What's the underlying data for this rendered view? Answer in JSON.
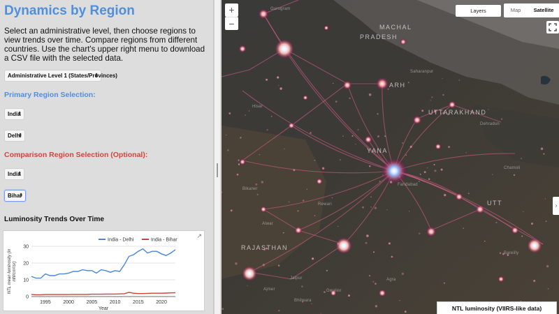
{
  "panel": {
    "title": "Dynamics by Region",
    "description": "Select an administrative level, then choose regions to view trends over time. Compare regions from different countries. Use the chart's upper right menu to download a CSV file with the selected data.",
    "admin_level_select": "Administrative Level 1 (States/Provinces)",
    "primary_heading": "Primary Region Selection:",
    "primary_country_select": "India",
    "primary_region_select": "Delhi",
    "comparison_heading": "Comparison Region Selection (Optional):",
    "comparison_country_select": "India",
    "comparison_region_select": "Bihar",
    "trend_heading": "Luminosity Trends Over Time"
  },
  "chart_data": {
    "type": "line",
    "title": "",
    "xlabel": "Year",
    "ylabel": "NTL mean luminosity (in nW/cm²/sr)",
    "ylabel_lines": [
      "NTL mean luminosity (in",
      "nW/cm²/sr)"
    ],
    "xlim": [
      1992,
      2023
    ],
    "ylim": [
      0,
      30
    ],
    "xticks": [
      "1995",
      "2000",
      "2005",
      "2010",
      "2015",
      "2020"
    ],
    "yticks": [
      "0",
      "10",
      "20",
      "30"
    ],
    "legend_position": "top-right",
    "grid": true,
    "x": [
      1992,
      1993,
      1994,
      1995,
      1996,
      1997,
      1998,
      1999,
      2000,
      2001,
      2002,
      2003,
      2004,
      2005,
      2006,
      2007,
      2008,
      2009,
      2010,
      2011,
      2012,
      2013,
      2014,
      2015,
      2016,
      2017,
      2018,
      2019,
      2020,
      2021,
      2022,
      2023
    ],
    "series": [
      {
        "name": "India - Delhi",
        "color": "#4a86d8",
        "values": [
          12,
          11,
          11,
          13.5,
          12.5,
          12.5,
          13.5,
          13.5,
          14,
          15,
          15,
          16,
          15.5,
          15.5,
          14,
          16,
          15.5,
          14.5,
          15.5,
          15,
          19,
          24,
          25,
          27,
          28.5,
          26,
          27,
          27,
          25.5,
          24.5,
          26,
          28
        ]
      },
      {
        "name": "India - Bihar",
        "color": "#cf4236",
        "values": [
          1.2,
          1.1,
          1.1,
          1.2,
          1.2,
          1.2,
          1.2,
          1.2,
          1.2,
          1.3,
          1.3,
          1.3,
          1.3,
          1.4,
          1.4,
          1.4,
          1.5,
          1.5,
          1.5,
          1.6,
          1.7,
          2.5,
          2,
          1.8,
          1.8,
          1.9,
          2,
          2,
          2,
          2.1,
          2.2,
          2.3
        ]
      }
    ]
  },
  "map": {
    "zoom_in": "+",
    "zoom_out": "−",
    "layers_button": "Layers",
    "map_type_map": "Map",
    "map_type_satellite": "Satellite",
    "legend_title": "NTL luminosity (VIIRS-like data)",
    "side_arrow": "›",
    "labels": {
      "himachal": "MACHAL",
      "pradesh": "PRADESH",
      "uttarakhand": "UTTARAKHAND",
      "rajasthan": "RAJASTHAN",
      "yana": "YANA",
      "arh": "ARH",
      "utt": "UTT",
      "guru": "Gurugram",
      "faridabad": "Faridabad",
      "sahar": "Saharanpur",
      "dehradun": "Dehradun",
      "rewari": "Rewari",
      "alwar": "Alwar",
      "bikaner": "Bikaner",
      "jaipur": "Jaipur",
      "ajmer": "Ajmer",
      "agra": "Agra",
      "gwalior": "Gwalior",
      "bareilly": "Bareilly",
      "hisar": "Hisar",
      "chamoli": "Chamoli",
      "bhilwara": "Bhilwara"
    }
  },
  "icons": {
    "chart_menu": "chart-expand-icon",
    "fullscreen": "fullscreen-icon",
    "select_arrow": "select-arrow-icon"
  }
}
